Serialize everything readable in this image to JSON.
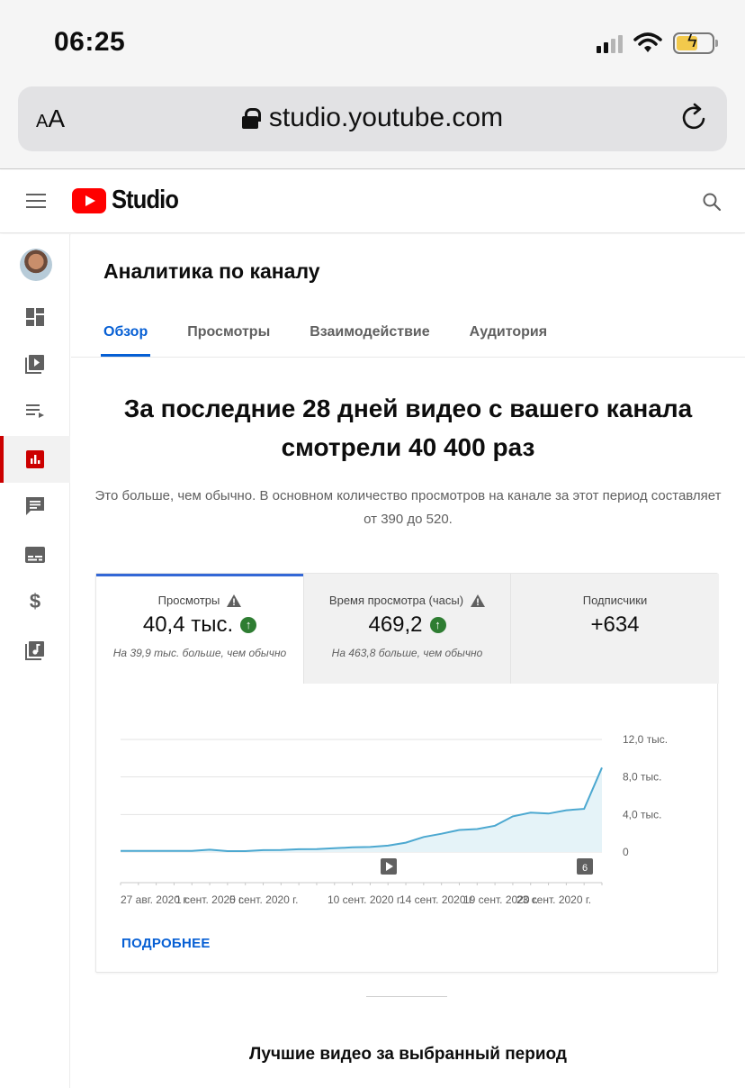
{
  "status_bar": {
    "time": "06:25"
  },
  "browser": {
    "text_size_label": "AA",
    "url": "studio.youtube.com"
  },
  "app": {
    "logo_text": "Studio"
  },
  "page": {
    "title": "Аналитика по каналу",
    "tabs": [
      {
        "label": "Обзор",
        "active": true
      },
      {
        "label": "Просмотры",
        "active": false
      },
      {
        "label": "Взаимодействие",
        "active": false
      },
      {
        "label": "Аудитория",
        "active": false
      }
    ],
    "headline": "За последние 28 дней видео с вашего канала смотрели 40 400 раз",
    "subhead": "Это больше, чем обычно. В основном количество просмотров на канале за этот период составляет от 390 до 520."
  },
  "metrics": [
    {
      "label": "Просмотры",
      "value": "40,4 тыс.",
      "note": "На 39,9 тыс. больше, чем обычно"
    },
    {
      "label": "Время просмотра (часы)",
      "value": "469,2",
      "note": "На 463,8 больше, чем обычно"
    },
    {
      "label": "Подписчики",
      "value": "+634",
      "note": ""
    }
  ],
  "chart_data": {
    "type": "area",
    "y_ticks": [
      "12,0 тыс.",
      "8,0 тыс.",
      "4,0 тыс.",
      "0"
    ],
    "ylim": [
      0,
      12000
    ],
    "x_tick_labels": [
      "27 авг. 2020 г.",
      "1 сент. 2020 г.",
      "5 сент. 2020 г.",
      "10 сент. 2020 г.",
      "14 сент. 2020 г.",
      "19 сент. 2020 г.",
      "23 сент. 2020 г."
    ],
    "values": [
      120,
      120,
      120,
      120,
      120,
      250,
      100,
      100,
      200,
      220,
      300,
      320,
      400,
      500,
      540,
      680,
      1000,
      1600,
      1950,
      2350,
      2450,
      2800,
      3800,
      4200,
      4100,
      4450,
      4600,
      9000
    ],
    "markers": [
      "▶",
      "6"
    ],
    "line_color": "#4ca8d0",
    "fill_color": "#e5f3f8"
  },
  "links": {
    "more": "ПОДРОБНЕЕ"
  },
  "section": {
    "best_videos_title": "Лучшие видео за выбранный период"
  }
}
